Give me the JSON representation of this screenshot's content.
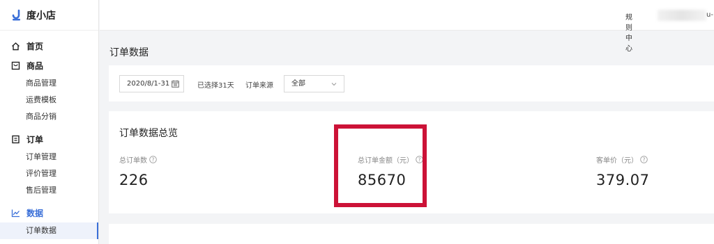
{
  "app": {
    "logo_text": "度小店"
  },
  "sidebar": {
    "home": "首页",
    "goods": {
      "label": "商品",
      "items": [
        "商品管理",
        "运费模板",
        "商品分销"
      ]
    },
    "orders": {
      "label": "订单",
      "items": [
        "订单管理",
        "评价管理",
        "售后管理"
      ]
    },
    "data": {
      "label": "数据",
      "items": [
        "订单数据"
      ]
    }
  },
  "header": {
    "rules": "规则中心",
    "user_tail": "u-"
  },
  "page": {
    "title": "订单数据"
  },
  "filters": {
    "date_range": "2020/8/1-31",
    "selected_days": "已选择31天",
    "source_label": "订单来源",
    "source_value": "全部"
  },
  "overview": {
    "title": "订单数据总览",
    "metrics": [
      {
        "label": "总订单数",
        "value": "226"
      },
      {
        "label": "总订单金额（元）",
        "value": "85670"
      },
      {
        "label": "客单价（元）",
        "value": "379.07"
      }
    ]
  },
  "colors": {
    "accent": "#3a6fd8",
    "highlight": "#cc1237"
  }
}
